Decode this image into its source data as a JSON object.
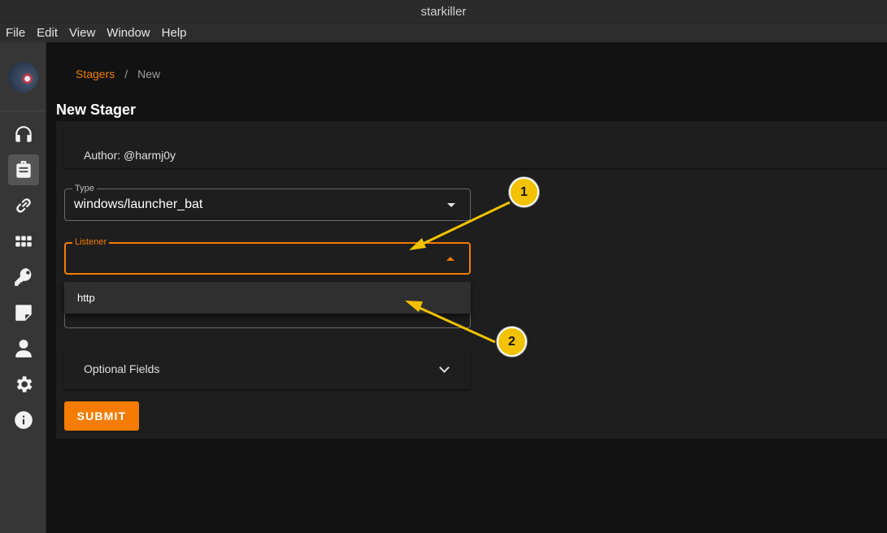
{
  "window": {
    "title": "starkiller"
  },
  "menu": [
    "File",
    "Edit",
    "View",
    "Window",
    "Help"
  ],
  "breadcrumb": {
    "parent": "Stagers",
    "separator": "/",
    "current": "New"
  },
  "page_title": "New Stager",
  "author": "Author: @harmj0y",
  "type_field": {
    "label": "Type",
    "value": "windows/launcher_bat"
  },
  "listener_field": {
    "label": "Listener",
    "value": ""
  },
  "dropdown": {
    "options": [
      "http"
    ]
  },
  "optional_fields": "Optional Fields",
  "submit_label": "SUBMIT",
  "annotations": [
    "1",
    "2"
  ],
  "colors": {
    "accent": "#f57c00",
    "annotation": "#f2c200",
    "background": "#121212",
    "card": "#1e1e1e",
    "sidebar": "#363636"
  },
  "sidebar_icons": [
    "headphones-icon",
    "briefcase-icon",
    "link-icon",
    "grid-icon",
    "key-icon",
    "note-icon",
    "user-icon",
    "gear-icon",
    "info-icon"
  ]
}
